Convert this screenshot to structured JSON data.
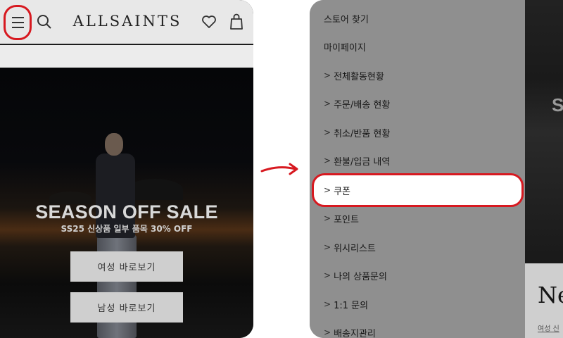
{
  "left_screen": {
    "header": {
      "brand": "ALLSAINTS"
    },
    "hero": {
      "title": "SEASON OFF SALE",
      "subtitle": "SS25 신상품 일부 품목 30% OFF",
      "women_button": "여성 바로보기",
      "men_button": "남성 바로보기"
    }
  },
  "right_screen": {
    "menu": {
      "store_finder": "스토어 찾기",
      "my_page": "마이페이지",
      "items": [
        "전체활동현황",
        "주문/배송 현황",
        "취소/반품 현황",
        "환불/입금 내역",
        "쿠폰",
        "포인트",
        "위시리스트",
        "나의 상품문의",
        "1:1 문의",
        "배송지관리"
      ],
      "chevron": ">"
    },
    "background_peek": {
      "hero_letter": "S",
      "heading_fragment": "Ne",
      "link_fragment": "여성 신"
    }
  },
  "colors": {
    "highlight": "#d71920",
    "menu_overlay": "#8f8f8f",
    "hero_button": "#cfcfcf"
  },
  "icons": [
    "hamburger-menu-icon",
    "search-icon",
    "heart-icon",
    "shopping-bag-icon",
    "chevron-right-icon",
    "red-arrow-icon"
  ]
}
